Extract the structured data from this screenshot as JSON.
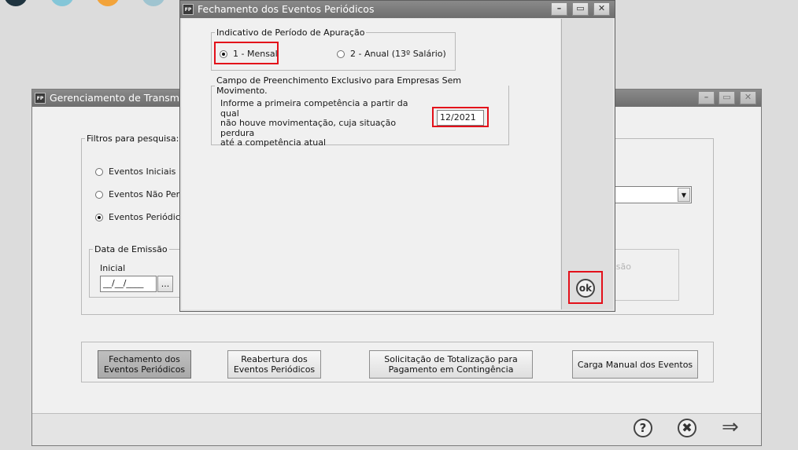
{
  "background_window": {
    "title": "Gerenciamento de Transmiss",
    "filters_legend": "Filtros para pesquisa:",
    "radio_initial": "Eventos Iniciais",
    "radio_non_periodic": "Eventos Não Perió",
    "radio_periodic": "Eventos Periódicos",
    "radio_selected": "periodic",
    "date_legend": "Data de Emissão",
    "initial_label": "Inicial",
    "initial_value": "__/__/____",
    "date_picker_label": "...",
    "faded_label": "ssão",
    "buttons": {
      "close_periodic": "Fechamento dos Eventos Periódicos",
      "reopen_periodic": "Reabertura dos Eventos Periódicos",
      "totalization_request": "Solicitação de Totalização para Pagamento em Contingência",
      "manual_load": "Carga Manual dos Eventos"
    }
  },
  "dialog": {
    "title": "Fechamento dos Eventos Periódicos",
    "period_legend": "Indicativo de Período de Apuração",
    "option_monthly": "1 - Mensal",
    "option_annual": "2 - Anual (13º Salário)",
    "selected_option": "monthly",
    "exclusive_legend": "Campo de Preenchimento Exclusivo para Empresas Sem Movimento.",
    "info_text_line1": "Informe a primeira competência a partir da  qual",
    "info_text_line2": "não houve movimentação, cuja situação perdura",
    "info_text_line3": "até a competência atual",
    "competence_value": "12/2021",
    "ok_label": "ok"
  },
  "icons": {
    "help": "question-icon",
    "cancel": "x-circle-icon",
    "next": "arrow-right-icon"
  },
  "colors": {
    "highlight": "#e3101a",
    "titlebar": "#7b7b7b"
  }
}
